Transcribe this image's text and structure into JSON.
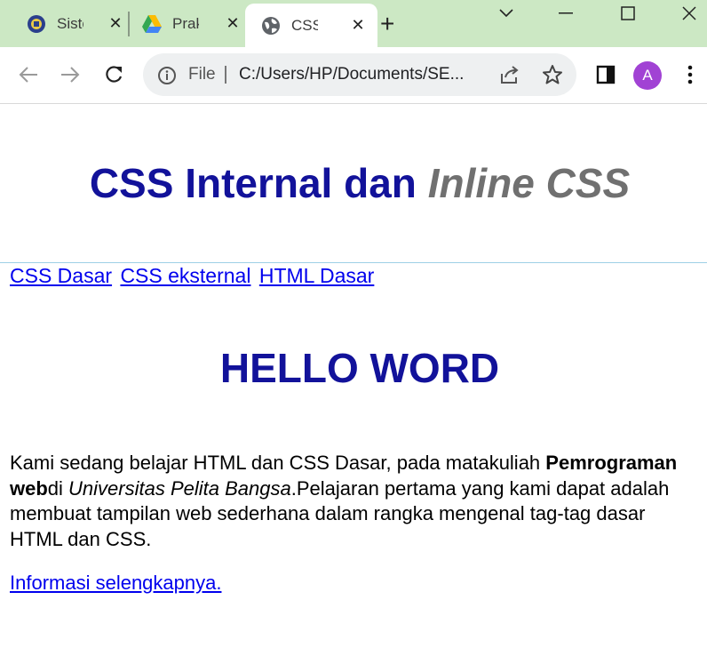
{
  "browser": {
    "tabs": [
      {
        "title": "Sistem",
        "icon": "university-logo-icon"
      },
      {
        "title": "Praktikum",
        "icon": "google-drive-icon"
      },
      {
        "title": "CSS Internal dan Inline CSS",
        "icon": "globe-icon",
        "active": true
      }
    ],
    "address": {
      "scheme_label": "File",
      "url": "C:/Users/HP/Documents/SE..."
    },
    "profile_initial": "A",
    "colors": {
      "tabstrip": "#cce8c4",
      "profile": "#a142d4"
    }
  },
  "page": {
    "title_part1": "CSS Internal dan ",
    "title_part2": "Inline CSS",
    "nav_links": [
      "CSS Dasar",
      "CSS eksternal",
      "HTML Dasar"
    ],
    "heading": "HELLO WORD",
    "paragraph": {
      "part1": "Kami sedang belajar HTML dan CSS Dasar, pada matakuliah ",
      "bold": "Pemrograman web",
      "part2": "di ",
      "italic": "Universitas Pelita Bangsa",
      "part3": ".Pelajaran pertama yang kami dapat adalah membuat tampilan web sederhana dalam rangka mengenal tag-tag dasar HTML dan CSS."
    },
    "more_link": "Informasi selengkapnya.",
    "colors": {
      "heading": "#12129a",
      "italic_title": "#707070",
      "link": "#0000ee"
    }
  }
}
